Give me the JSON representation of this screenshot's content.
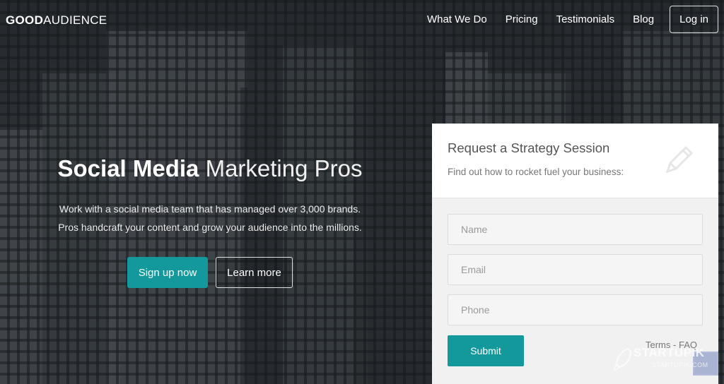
{
  "brand": {
    "bold": "GOOD",
    "light": "AUDIENCE"
  },
  "nav": {
    "items": [
      "What We Do",
      "Pricing",
      "Testimonials",
      "Blog"
    ],
    "login": "Log in"
  },
  "hero": {
    "title_bold": "Social Media",
    "title_light": "Marketing Pros",
    "line1": "Work with a social media team that has managed over 3,000 brands.",
    "line2": "Pros handcraft your content and grow your audience into the millions.",
    "signup": "Sign up now",
    "learn": "Learn more"
  },
  "form": {
    "title": "Request a Strategy Session",
    "subtitle": "Find out how to rocket fuel your business:",
    "name_placeholder": "Name",
    "email_placeholder": "Email",
    "phone_placeholder": "Phone",
    "submit": "Submit",
    "terms": "Terms",
    "separator": "-",
    "faq": "FAQ"
  },
  "watermark": {
    "name": "STARTUPIK",
    "url": "STARTUPIK.COM"
  },
  "colors": {
    "accent": "#13999b"
  }
}
